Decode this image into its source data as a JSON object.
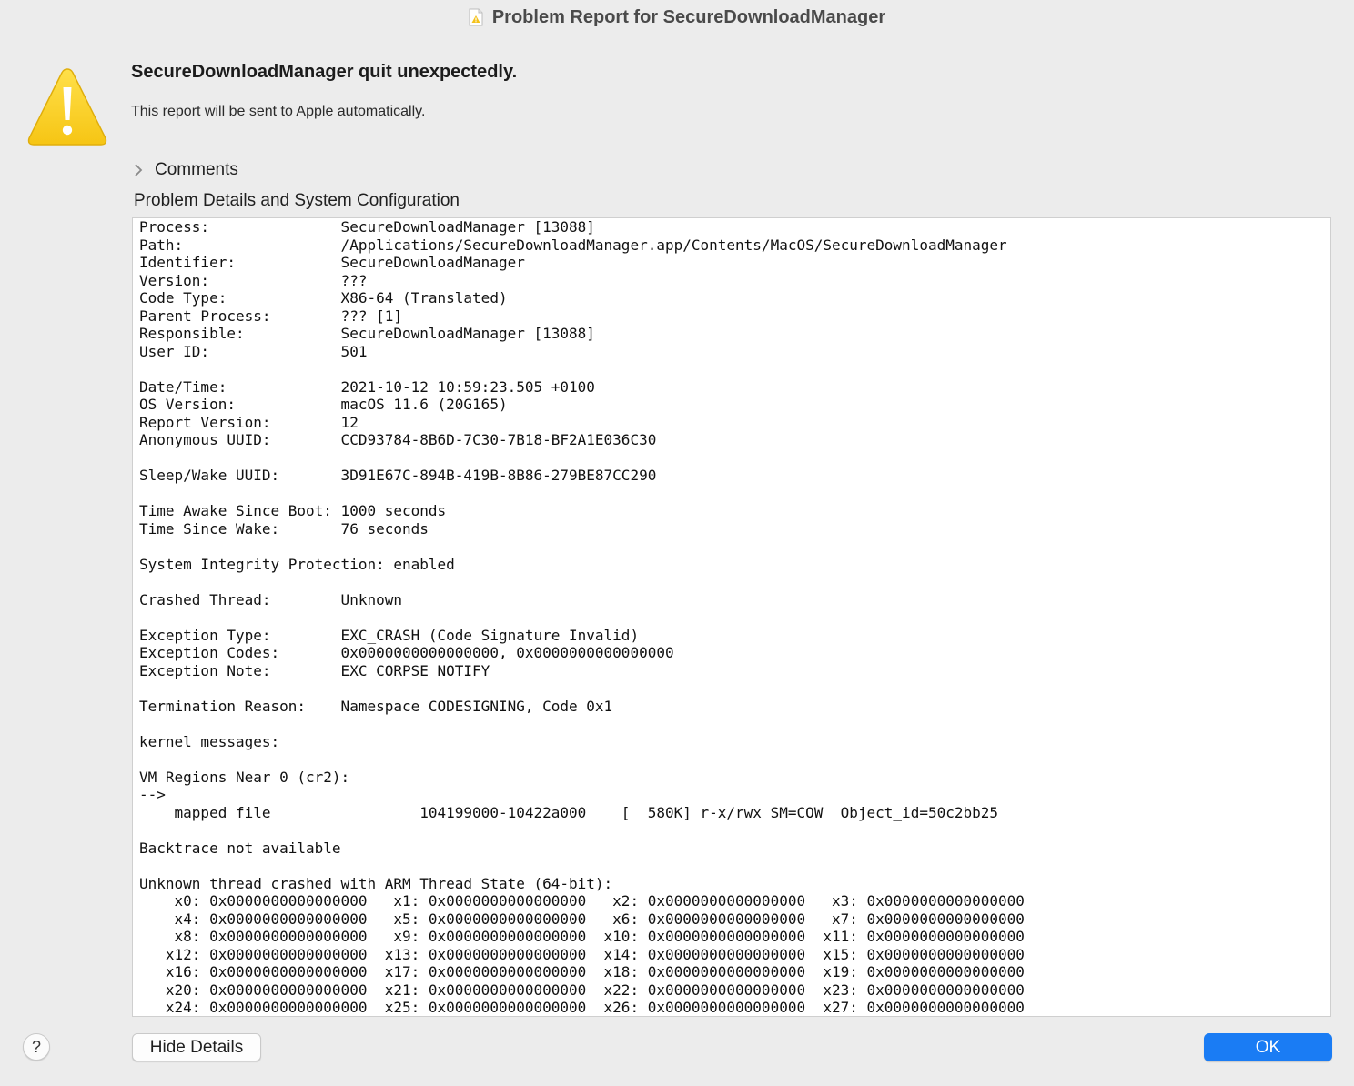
{
  "window": {
    "title": "Problem Report for SecureDownloadManager",
    "title_icon": "document-warning-icon"
  },
  "alert": {
    "icon": "warning-triangle-icon",
    "headline": "SecureDownloadManager quit unexpectedly.",
    "subline": "This report will be sent to Apple automatically."
  },
  "comments": {
    "label": "Comments",
    "icon": "chevron-right-icon"
  },
  "details": {
    "heading": "Problem Details and System Configuration",
    "lines": [
      "Process:               SecureDownloadManager [13088]",
      "Path:                  /Applications/SecureDownloadManager.app/Contents/MacOS/SecureDownloadManager",
      "Identifier:            SecureDownloadManager",
      "Version:               ???",
      "Code Type:             X86-64 (Translated)",
      "Parent Process:        ??? [1]",
      "Responsible:           SecureDownloadManager [13088]",
      "User ID:               501",
      "",
      "Date/Time:             2021-10-12 10:59:23.505 +0100",
      "OS Version:            macOS 11.6 (20G165)",
      "Report Version:        12",
      "Anonymous UUID:        CCD93784-8B6D-7C30-7B18-BF2A1E036C30",
      "",
      "Sleep/Wake UUID:       3D91E67C-894B-419B-8B86-279BE87CC290",
      "",
      "Time Awake Since Boot: 1000 seconds",
      "Time Since Wake:       76 seconds",
      "",
      "System Integrity Protection: enabled",
      "",
      "Crashed Thread:        Unknown",
      "",
      "Exception Type:        EXC_CRASH (Code Signature Invalid)",
      "Exception Codes:       0x0000000000000000, 0x0000000000000000",
      "Exception Note:        EXC_CORPSE_NOTIFY",
      "",
      "Termination Reason:    Namespace CODESIGNING, Code 0x1",
      "",
      "kernel messages:",
      "",
      "VM Regions Near 0 (cr2):",
      "-->",
      "    mapped file                 104199000-10422a000    [  580K] r-x/rwx SM=COW  Object_id=50c2bb25",
      "",
      "Backtrace not available",
      "",
      "Unknown thread crashed with ARM Thread State (64-bit):",
      "    x0: 0x0000000000000000   x1: 0x0000000000000000   x2: 0x0000000000000000   x3: 0x0000000000000000",
      "    x4: 0x0000000000000000   x5: 0x0000000000000000   x6: 0x0000000000000000   x7: 0x0000000000000000",
      "    x8: 0x0000000000000000   x9: 0x0000000000000000  x10: 0x0000000000000000  x11: 0x0000000000000000",
      "   x12: 0x0000000000000000  x13: 0x0000000000000000  x14: 0x0000000000000000  x15: 0x0000000000000000",
      "   x16: 0x0000000000000000  x17: 0x0000000000000000  x18: 0x0000000000000000  x19: 0x0000000000000000",
      "   x20: 0x0000000000000000  x21: 0x0000000000000000  x22: 0x0000000000000000  x23: 0x0000000000000000",
      "   x24: 0x0000000000000000  x25: 0x0000000000000000  x26: 0x0000000000000000  x27: 0x0000000000000000"
    ]
  },
  "footer": {
    "help_label": "?",
    "hide_details_label": "Hide Details",
    "ok_label": "OK",
    "accent_color": "#1a7cf4"
  }
}
